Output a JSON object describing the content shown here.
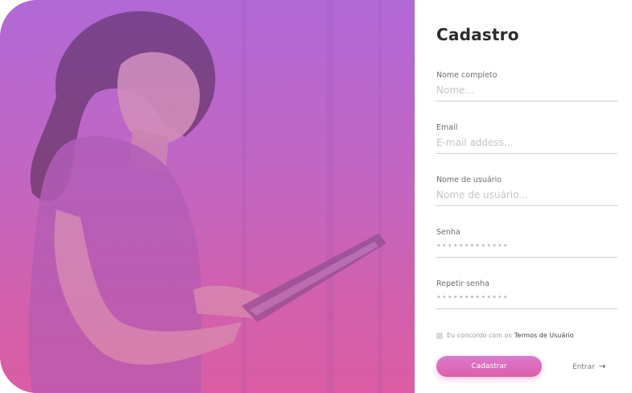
{
  "hero": {
    "image_icon": "woman-with-tablet-photo",
    "gradient_top": "#b06ad6",
    "gradient_bottom": "#e3599a"
  },
  "form": {
    "title": "Cadastro",
    "fields": [
      {
        "label": "Nome completo",
        "placeholder": "Nome..."
      },
      {
        "label": "Email",
        "placeholder": "E-mail addess..."
      },
      {
        "label": "Nome de usuário",
        "placeholder": "Nome de usuário..."
      },
      {
        "label": "Senha",
        "placeholder": "•••••••••••••"
      },
      {
        "label": "Repetir senha",
        "placeholder": "•••••••••••••"
      }
    ],
    "terms": {
      "text": "Eu concordo com os",
      "link": "Termos de Usuário"
    },
    "submit_label": "Cadastrar",
    "login_link": "Entrar",
    "login_arrow": "→",
    "accent_color": "#df5fa6"
  }
}
